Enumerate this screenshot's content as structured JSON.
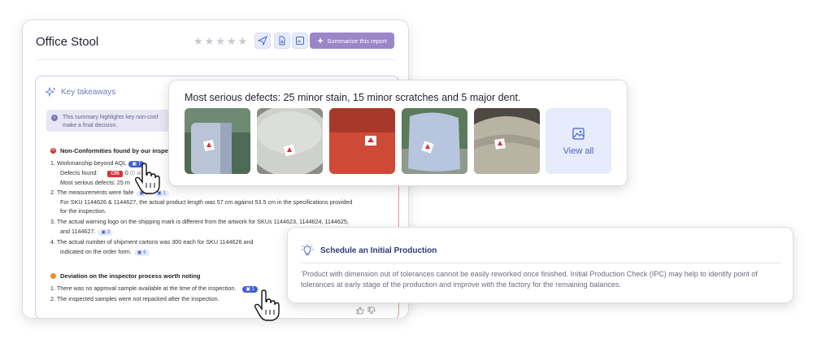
{
  "report": {
    "title": "Office Stool",
    "rating": {
      "max": 5,
      "value": 0
    },
    "summarize_label": "Summarize this report",
    "takeaways_label": "Key takeaways",
    "info_text_1": "This summary highlights key non-conf",
    "info_text_2": "make a final decision.",
    "nonconformities": {
      "heading": "Non-Conformities found by our inspec",
      "item1": "1.  Workmanship beyond AQL",
      "item1_ref": "7",
      "defects_label": "Defects found:",
      "cri_badge": "CRI",
      "cri_count": "0",
      "cri_extra": "(0 al",
      "serious_prefix": "Most serious defects: 25 m",
      "serious_suffix": "1,",
      "item2": "2.  The measurements were faile",
      "item2_ref": "2",
      "item2_ref2": "1",
      "item2_detail_1": "For SKU 1144626 & 1144627, the actual  product length was 57 cm against 53.5 cm in the specifications provided",
      "item2_detail_2": "for the inspection.",
      "item3_1": "3.  The actual warning logo on the shipping mark is different from the artwork for SKUs 1144623, 1144624, 1144625,",
      "item3_2": "and 1144627.",
      "item3_ref": "3",
      "item4_1": "4.  The actual number of shipment cartons was 300 each for SKU 1144626 and",
      "item4_2": "indicated on the order form.",
      "item4_ref": "6"
    },
    "deviation": {
      "heading": "Deviation on the inspector process worth noting",
      "item1": "1.  There was no approval sample available at the time of the inspection.",
      "item1_ref": "1",
      "item2": "2.  The inspected samples were not repacked after the inspection."
    }
  },
  "defects_popover": {
    "title": "Most serious defects: 25 minor stain, 15 minor scratches and 5 major dent.",
    "photos": [
      {
        "name": "photo-1",
        "color": "#b9c4d6"
      },
      {
        "name": "photo-2",
        "color": "#cfd2cc"
      },
      {
        "name": "photo-3",
        "color": "#cf4a36"
      },
      {
        "name": "photo-4",
        "color": "#b7c6de"
      },
      {
        "name": "photo-5",
        "color": "#b9b3a4"
      }
    ],
    "view_all_label": "View all"
  },
  "schedule_popover": {
    "title": "Schedule an Initial Production",
    "body": "‘Product with dimension out of tolerances cannot be easily reworked once finished. Initial Production Check (IPC) may help to identify point of tolerances at early stage of the production and improve with the factory for the remaining balances."
  },
  "colors": {
    "accent": "#3f5fd2",
    "summarize": "#9b86c9",
    "critical": "#d9303a",
    "warning": "#f08c2b"
  }
}
